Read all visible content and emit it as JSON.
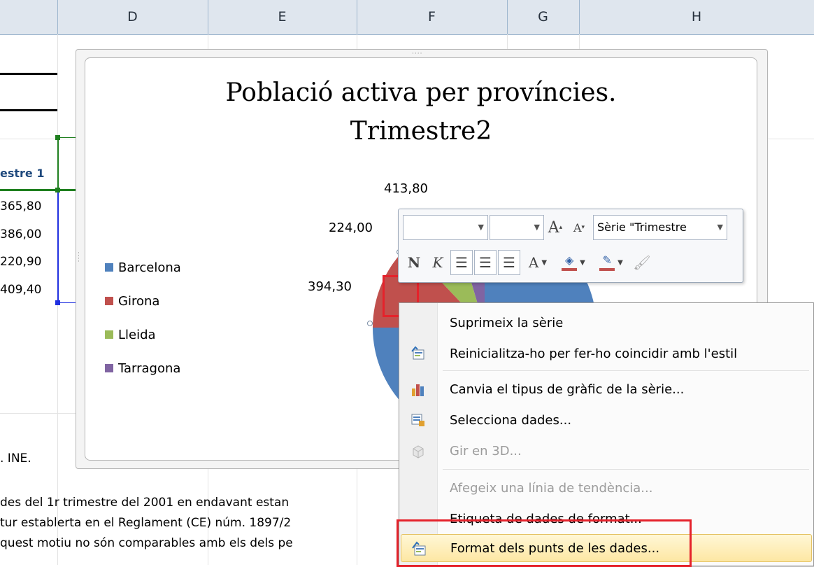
{
  "columns": [
    "D",
    "E",
    "F",
    "G",
    "H"
  ],
  "sheet": {
    "header_cell": "estre 1",
    "values": [
      "365,80",
      "386,00",
      "220,90",
      "409,40"
    ],
    "source": ". INE.",
    "notes": [
      " des del 1r trimestre del 2001 en endavant estan",
      "tur establerta en el Reglament (CE) núm. 1897/2",
      "quest motiu no són comparables amb els dels pe"
    ]
  },
  "chart": {
    "title_line1": "Població activa per províncies.",
    "title_line2": "Trimestre2"
  },
  "chart_data": {
    "type": "pie",
    "title": "Població activa per províncies. Trimestre2",
    "categories": [
      "Barcelona",
      "Girona",
      "Lleida",
      "Tarragona"
    ],
    "data_labels": [
      "394,30",
      "224,00",
      "413,80"
    ],
    "legend_position": "left",
    "colors": [
      "#4f81bd",
      "#c0504d",
      "#9bbb59",
      "#8064a2"
    ]
  },
  "mini_toolbar": {
    "series_select": "Sèrie \"Trimestre",
    "bold": "N",
    "italic": "K",
    "font_color_letter": "A",
    "grow_font": "A",
    "shrink_font": "A"
  },
  "context_menu": {
    "items": [
      {
        "label": "Suprimeix la sèrie",
        "icon": "",
        "disabled": false
      },
      {
        "label": "Reinicialitza-ho per fer-ho coincidir amb l'estil",
        "icon": "reset-style-icon",
        "disabled": false
      },
      {
        "label": "Canvia el tipus de gràfic de la sèrie...",
        "icon": "chart-type-icon",
        "disabled": false
      },
      {
        "label": "Selecciona dades...",
        "icon": "select-data-icon",
        "disabled": false
      },
      {
        "label": "Gir en 3D...",
        "icon": "rotation-3d-icon",
        "disabled": true
      },
      {
        "label": "Afegeix una línia de tendència...",
        "icon": "",
        "disabled": true
      },
      {
        "label": "Etiqueta de dades de format...",
        "icon": "",
        "disabled": false
      },
      {
        "label": "Format dels punts de les dades...",
        "icon": "format-data-point-icon",
        "disabled": false
      }
    ]
  }
}
